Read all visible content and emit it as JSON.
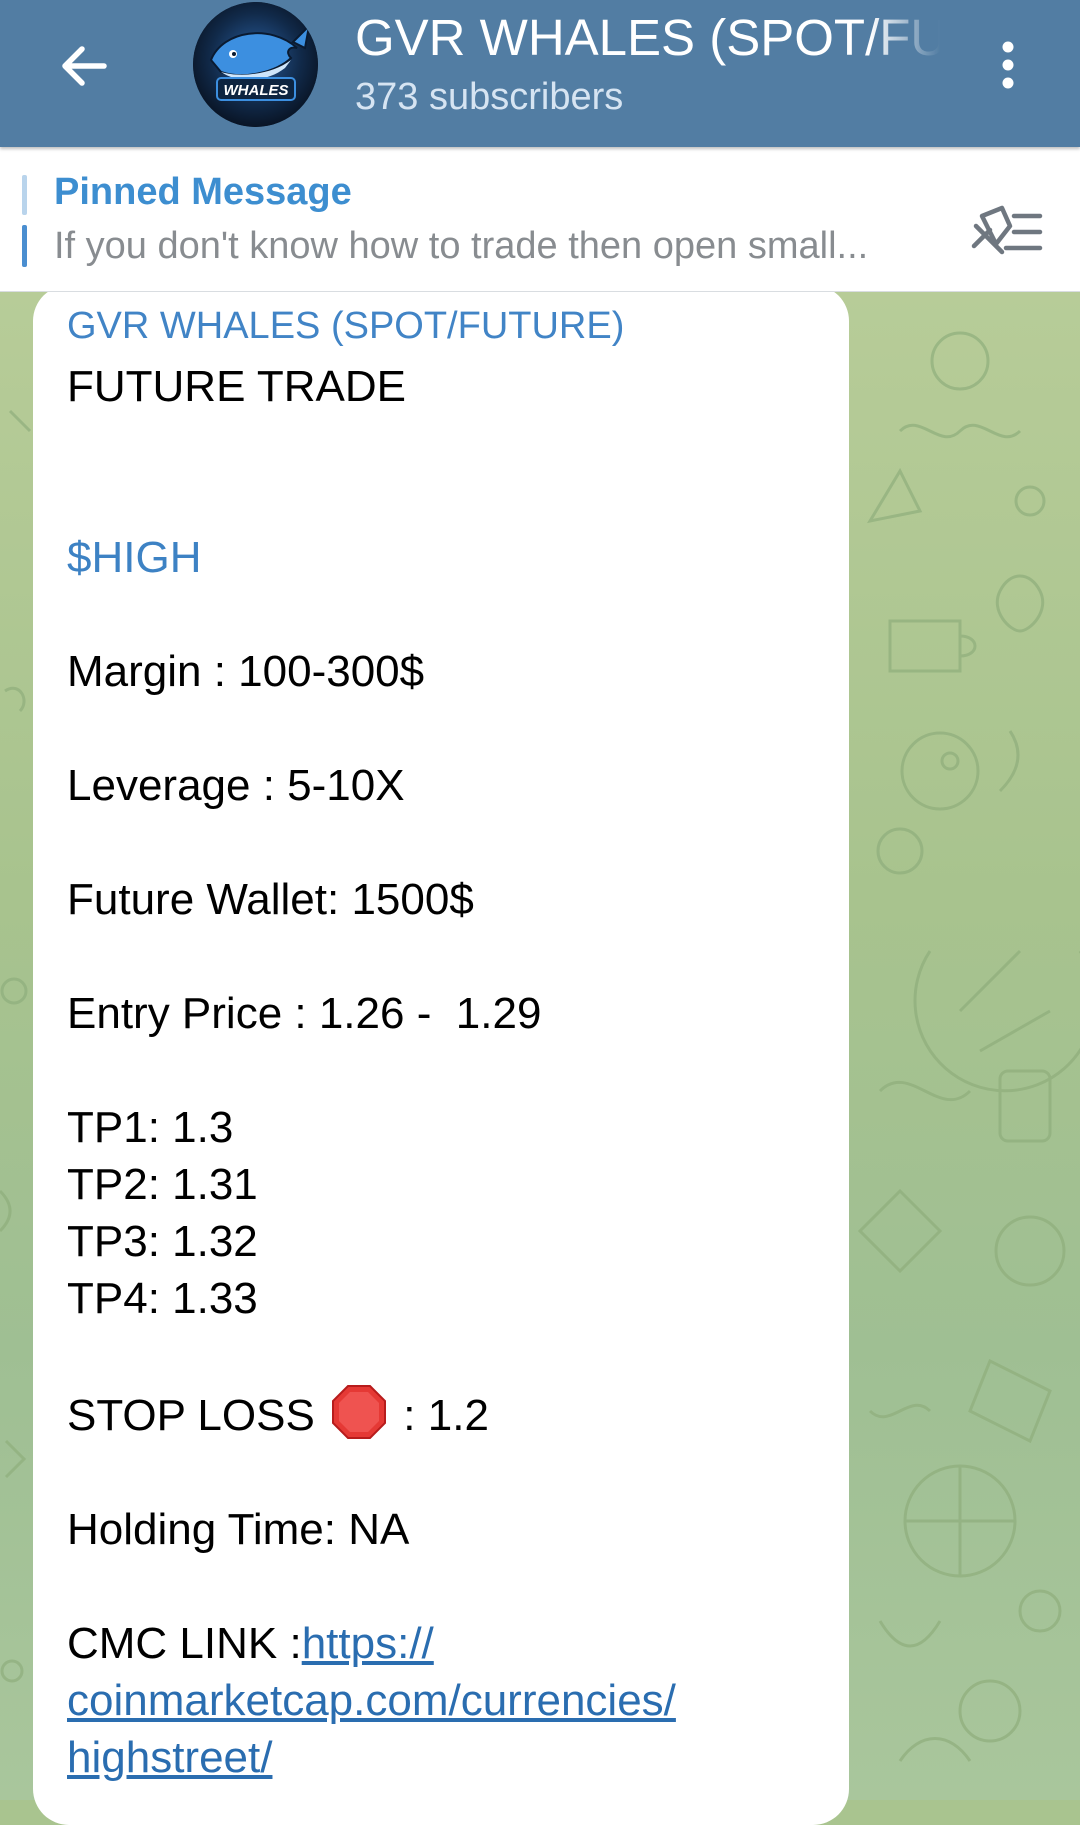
{
  "header": {
    "title": "GVR WHALES (SPOT/FUTURE)",
    "subtitle": "373 subscribers",
    "avatar_text": "WHALES",
    "back_icon": "arrow-left-icon",
    "menu_icon": "more-vertical-icon",
    "color": "#527da3"
  },
  "pinned": {
    "title": "Pinned Message",
    "text": "If you don't know how to trade then open small...",
    "icon": "pin-list-icon"
  },
  "message": {
    "author": "GVR WHALES (SPOT/FUTURE)",
    "heading": "FUTURE TRADE",
    "hashtag": "$HIGH",
    "margin": "Margin : 100-300$",
    "leverage": "Leverage : 5-10X",
    "future_wallet": "Future Wallet: 1500$",
    "entry_price": "Entry Price : 1.26 -  1.29",
    "tp1": "TP1: 1.3",
    "tp2": "TP2: 1.31",
    "tp3": "TP3: 1.32",
    "tp4": "TP4: 1.33",
    "stop_loss_label": "STOP LOSS",
    "stop_loss_value": ": 1.2",
    "stop_icon": "stop-sign-icon",
    "holding_time": "Holding Time: NA",
    "cmc_label": "CMC LINK :",
    "cmc_link_1": "https://",
    "cmc_link_2": "coinmarketcap.com/currencies/",
    "cmc_link_3": "highstreet/"
  }
}
